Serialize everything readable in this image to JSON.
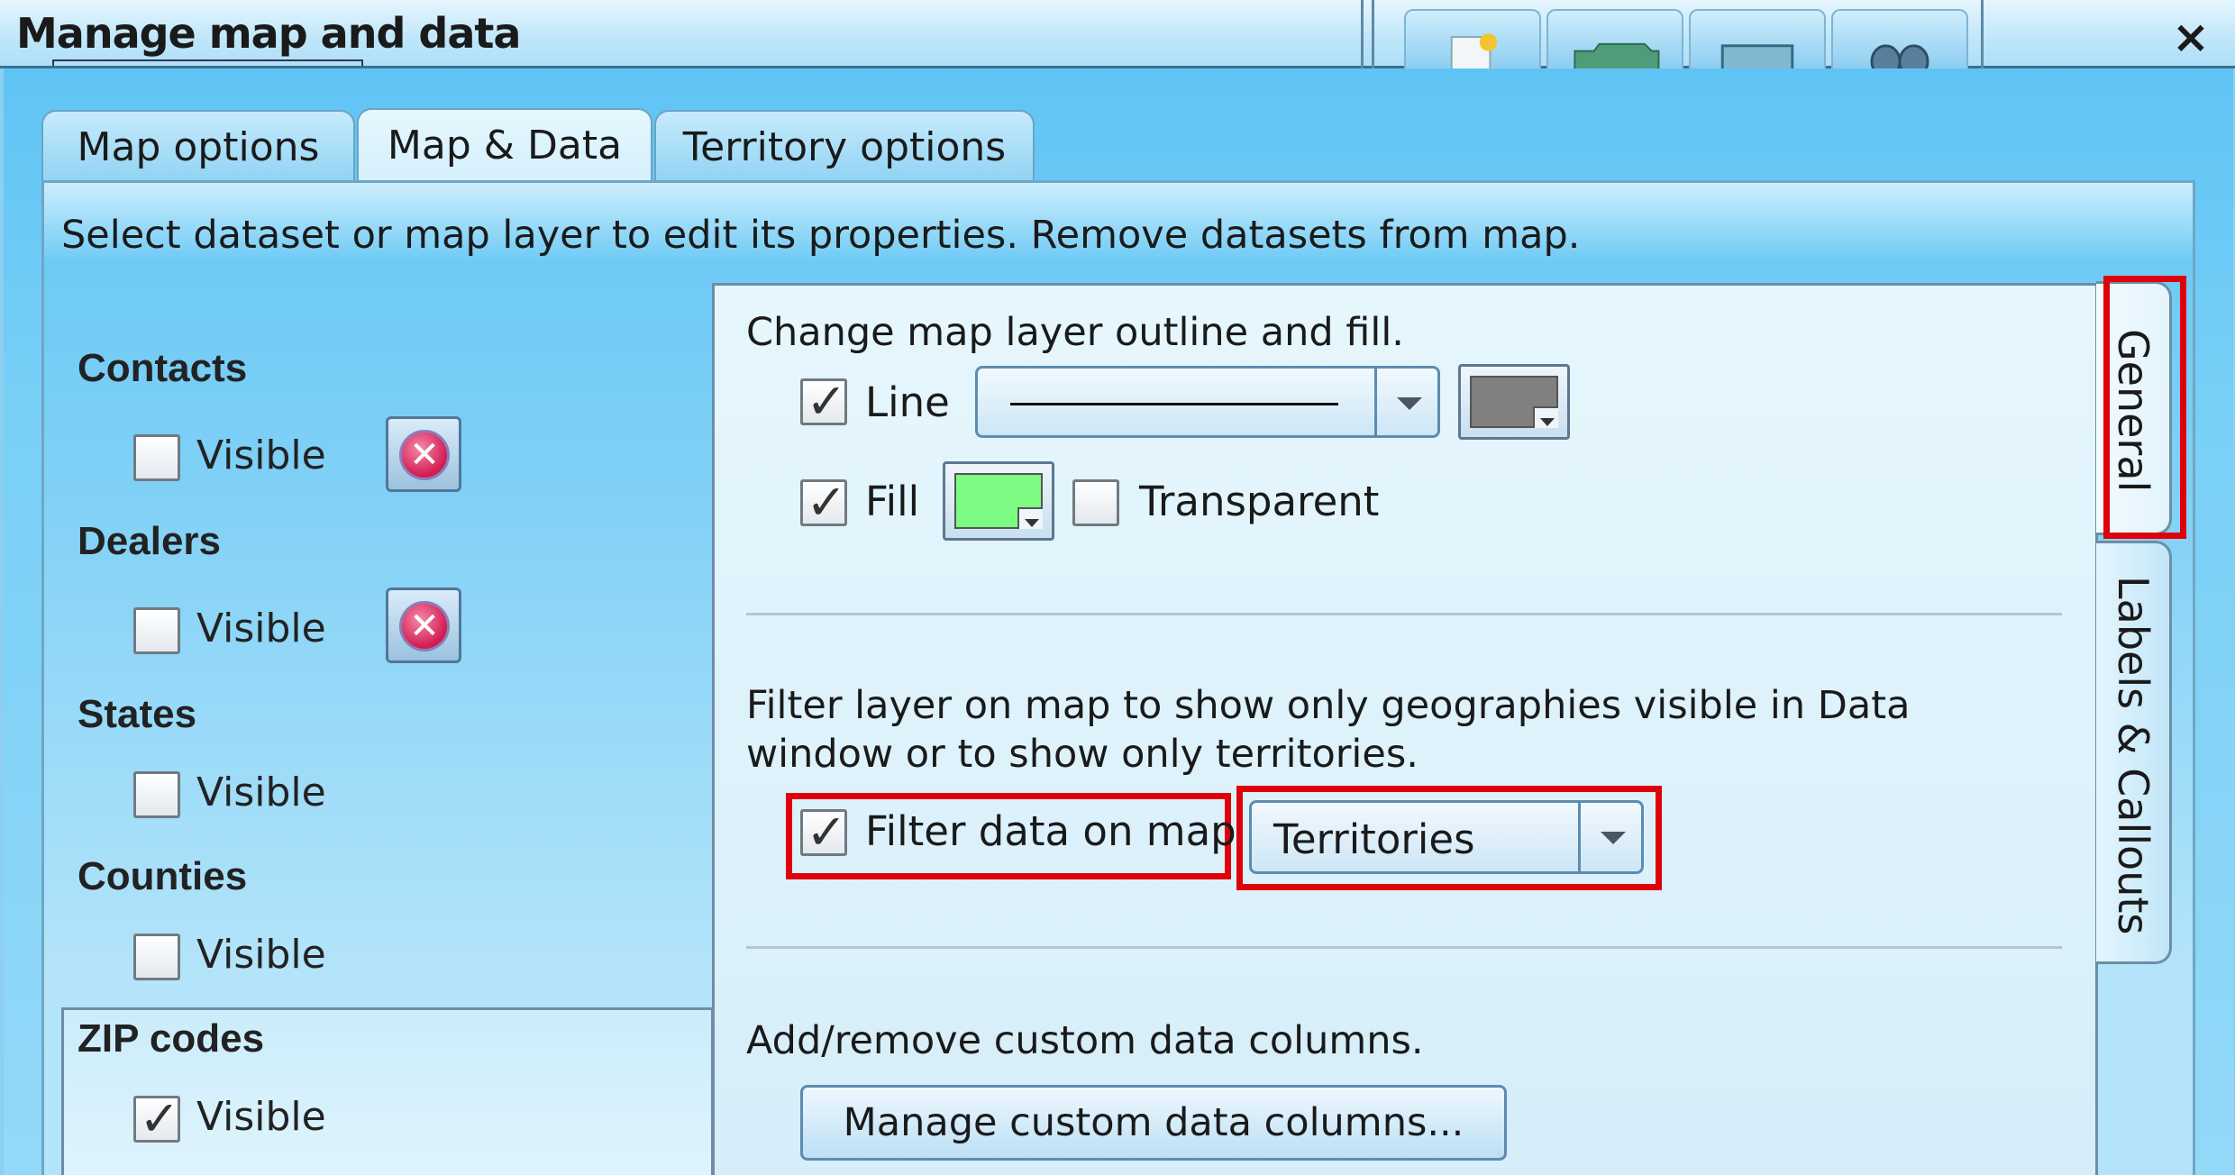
{
  "window": {
    "title": "Manage map and data",
    "close_glyph": "×",
    "toolbar_icons": [
      "new-icon",
      "folder-icon",
      "window-icon",
      "binoculars-icon"
    ]
  },
  "tabs": [
    {
      "label": "Map options",
      "active": false
    },
    {
      "label": "Map & Data",
      "active": true
    },
    {
      "label": "Territory options",
      "active": false
    }
  ],
  "instruction": "Select dataset or map layer to edit its properties. Remove datasets from map.",
  "datasets": [
    {
      "name": "Contacts",
      "visible_label": "Visible",
      "visible": false,
      "removable": true
    },
    {
      "name": "Dealers",
      "visible_label": "Visible",
      "visible": false,
      "removable": true
    },
    {
      "name": "States",
      "visible_label": "Visible",
      "visible": false,
      "removable": false
    },
    {
      "name": "Counties",
      "visible_label": "Visible",
      "visible": false,
      "removable": false
    },
    {
      "name": "ZIP codes",
      "visible_label": "Visible",
      "visible": true,
      "removable": false,
      "selected": true
    }
  ],
  "properties": {
    "outline_heading": "Change map layer outline and fill.",
    "line_label": "Line",
    "line_checked": true,
    "line_color": "#808080",
    "fill_label": "Fill",
    "fill_checked": true,
    "fill_color": "#7cfc82",
    "transparent_label": "Transparent",
    "transparent_checked": false,
    "filter_heading_1": "Filter layer on map to show only geographies visible in Data",
    "filter_heading_2": "window or to show only territories.",
    "filter_label": "Filter data on map",
    "filter_checked": true,
    "filter_select_value": "Territories",
    "custom_heading": "Add/remove custom data columns.",
    "custom_button": "Manage custom data columns..."
  },
  "side_tabs": [
    {
      "label": "General",
      "active": true
    },
    {
      "label": "Labels & Callouts",
      "active": false
    }
  ],
  "colors": {
    "highlight": "#e0000c",
    "window_bg": "#78cff6"
  }
}
